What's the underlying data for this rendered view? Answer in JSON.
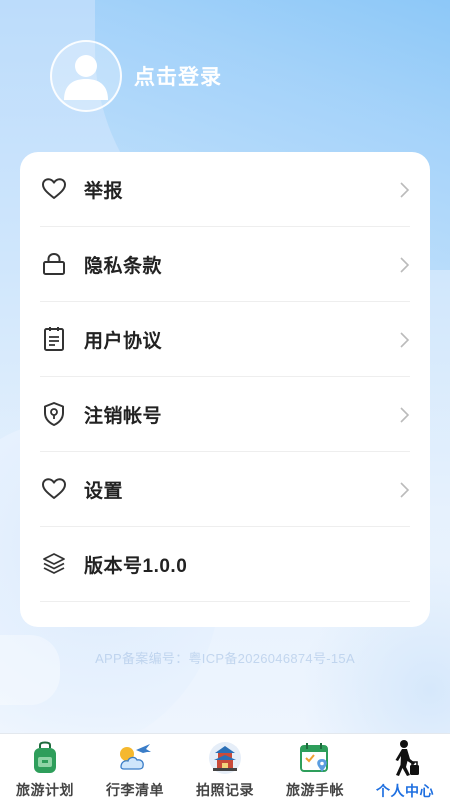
{
  "header": {
    "login_label": "点击登录"
  },
  "menu": {
    "items": [
      {
        "label": "举报",
        "icon": "heart-icon"
      },
      {
        "label": "隐私条款",
        "icon": "lock-icon"
      },
      {
        "label": "用户协议",
        "icon": "clipboard-icon"
      },
      {
        "label": "注销帐号",
        "icon": "shield-icon"
      },
      {
        "label": "设置",
        "icon": "heart-icon"
      },
      {
        "label": "版本号1.0.0",
        "icon": "layers-icon"
      }
    ]
  },
  "footer": {
    "icp": "APP备案编号：粤ICP备2026046874号-15A"
  },
  "tabbar": {
    "tabs": [
      {
        "label": "旅游计划",
        "icon": "backpack-icon",
        "active": false
      },
      {
        "label": "行李清单",
        "icon": "plane-cloud-icon",
        "active": false
      },
      {
        "label": "拍照记录",
        "icon": "pagoda-icon",
        "active": false
      },
      {
        "label": "旅游手帐",
        "icon": "calendar-map-icon",
        "active": false
      },
      {
        "label": "个人中心",
        "icon": "traveler-icon",
        "active": true
      }
    ],
    "active_color": "#1e6fe0"
  }
}
